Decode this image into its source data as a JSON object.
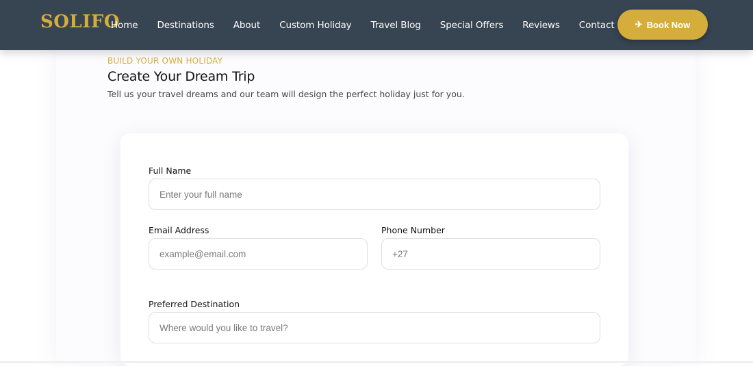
{
  "brand": {
    "name": "SOLIFO",
    "accent_color": "#d4ad3b",
    "nav_color": "#374451"
  },
  "nav": {
    "links": [
      "Home",
      "Destinations",
      "About",
      "Custom Holiday",
      "Travel Blog",
      "Special Offers",
      "Reviews",
      "Contact"
    ],
    "cta": {
      "icon": "airplane-icon",
      "label": "Book Now"
    }
  },
  "hero": {
    "eyebrow": "BUILD YOUR OWN HOLIDAY",
    "title": "Create Your Dream Trip",
    "subtitle": "Tell us your travel dreams and our team will design the perfect holiday just for you."
  },
  "form": {
    "full_name": {
      "label": "Full Name",
      "placeholder": "Enter your full name"
    },
    "email": {
      "label": "Email Address",
      "placeholder": "example@email.com"
    },
    "phone": {
      "label": "Phone Number",
      "placeholder": "+27"
    },
    "destination": {
      "label": "Preferred Destination",
      "placeholder": "Where would you like to travel?"
    }
  }
}
